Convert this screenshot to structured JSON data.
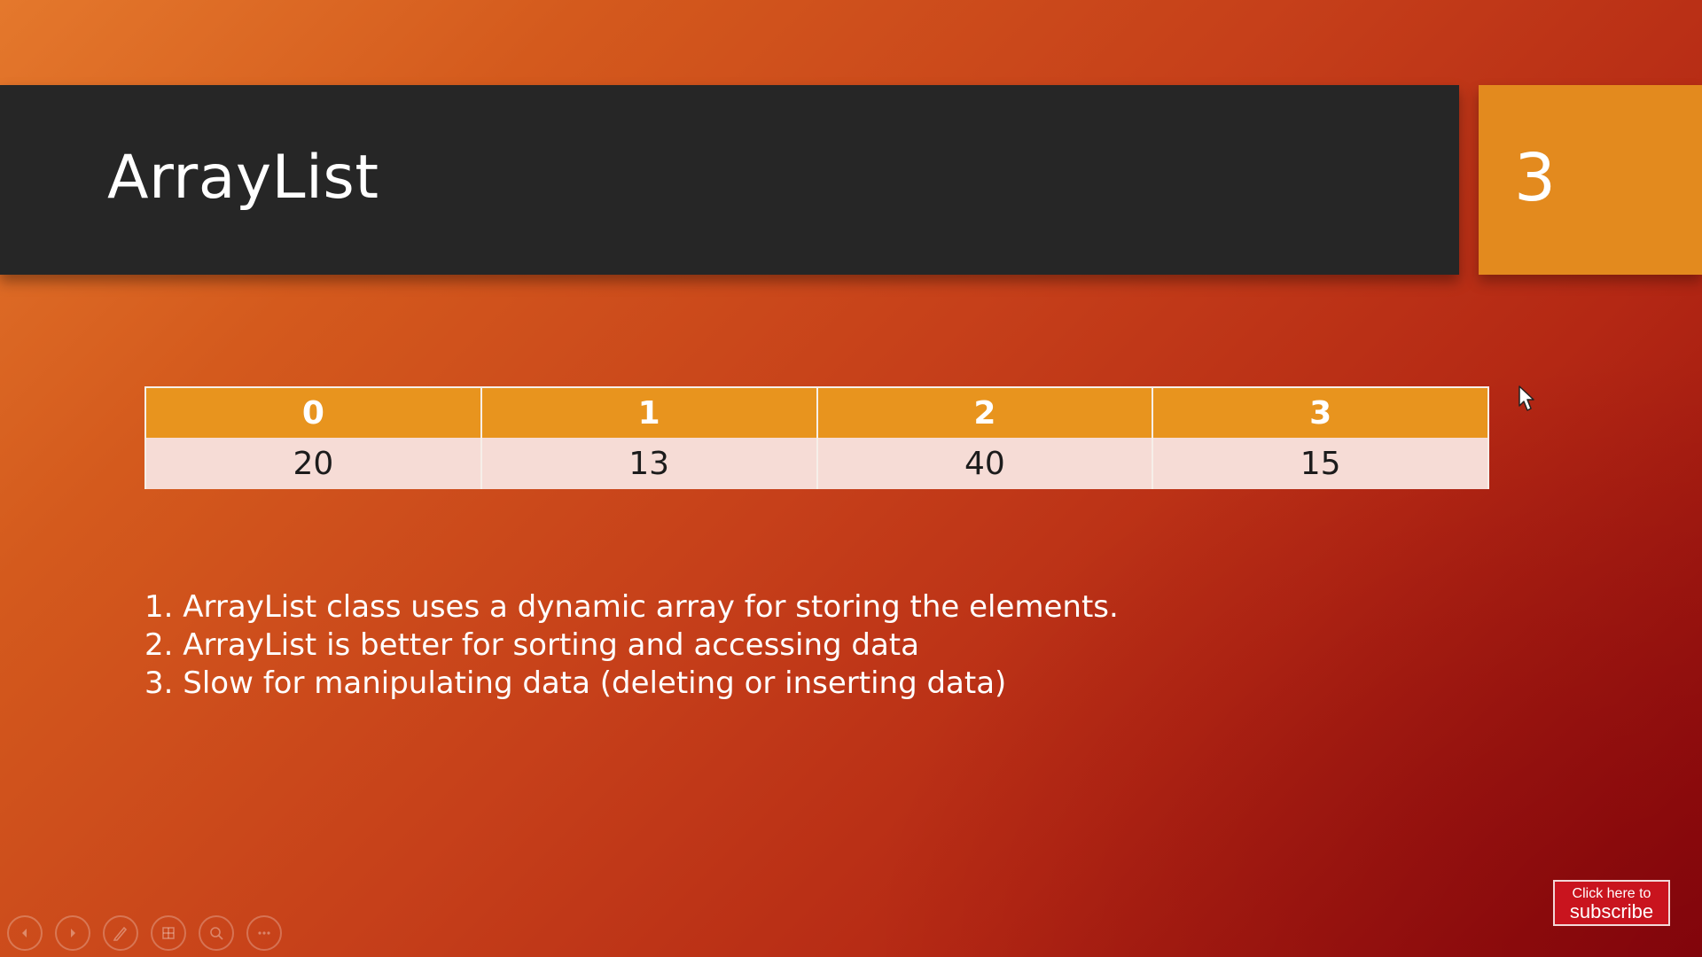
{
  "slide": {
    "title": "ArrayList",
    "number": "3"
  },
  "array_table": {
    "indices": [
      "0",
      "1",
      "2",
      "3"
    ],
    "values": [
      "20",
      "13",
      "40",
      "15"
    ]
  },
  "bullets": [
    "1. ArrayList class uses a dynamic array for storing the elements.",
    "2. ArrayList is better for sorting and accessing data",
    "3. Slow for manipulating data (deleting or inserting data)"
  ],
  "subscribe_button": {
    "line1": "Click here to",
    "line2": "subscribe"
  },
  "toolbar": {
    "icons": [
      "previous-icon",
      "next-icon",
      "pen-icon",
      "slides-grid-icon",
      "zoom-icon",
      "more-options-icon"
    ]
  },
  "colors": {
    "title_bar": "#262626",
    "accent_orange": "#e38a1e",
    "table_header": "#e8941e",
    "table_cell": "#f6dcd6",
    "subscribe_red": "#c9141e"
  }
}
